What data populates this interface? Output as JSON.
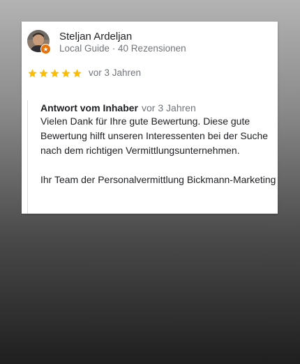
{
  "review": {
    "reviewer_name": "Steljan Ardeljan",
    "reviewer_meta": "Local Guide · 40 Rezensionen",
    "rating": 5,
    "rating_max": 5,
    "date": "vor 3 Jahren",
    "star_color": "#fbbc04",
    "badge_color": "#e8710a"
  },
  "owner_reply": {
    "title": "Antwort vom Inhaber",
    "date": "vor 3 Jahren",
    "paragraph_1": "Vielen Dank für Ihre gute Bewertung. Diese gute Bewertung hilft unseren Interessenten bei der Suche nach dem richtigen Vermittlungsunternehmen.",
    "paragraph_2": "Ihr Team der Personalvermittlung Bickmann-Marketing"
  }
}
